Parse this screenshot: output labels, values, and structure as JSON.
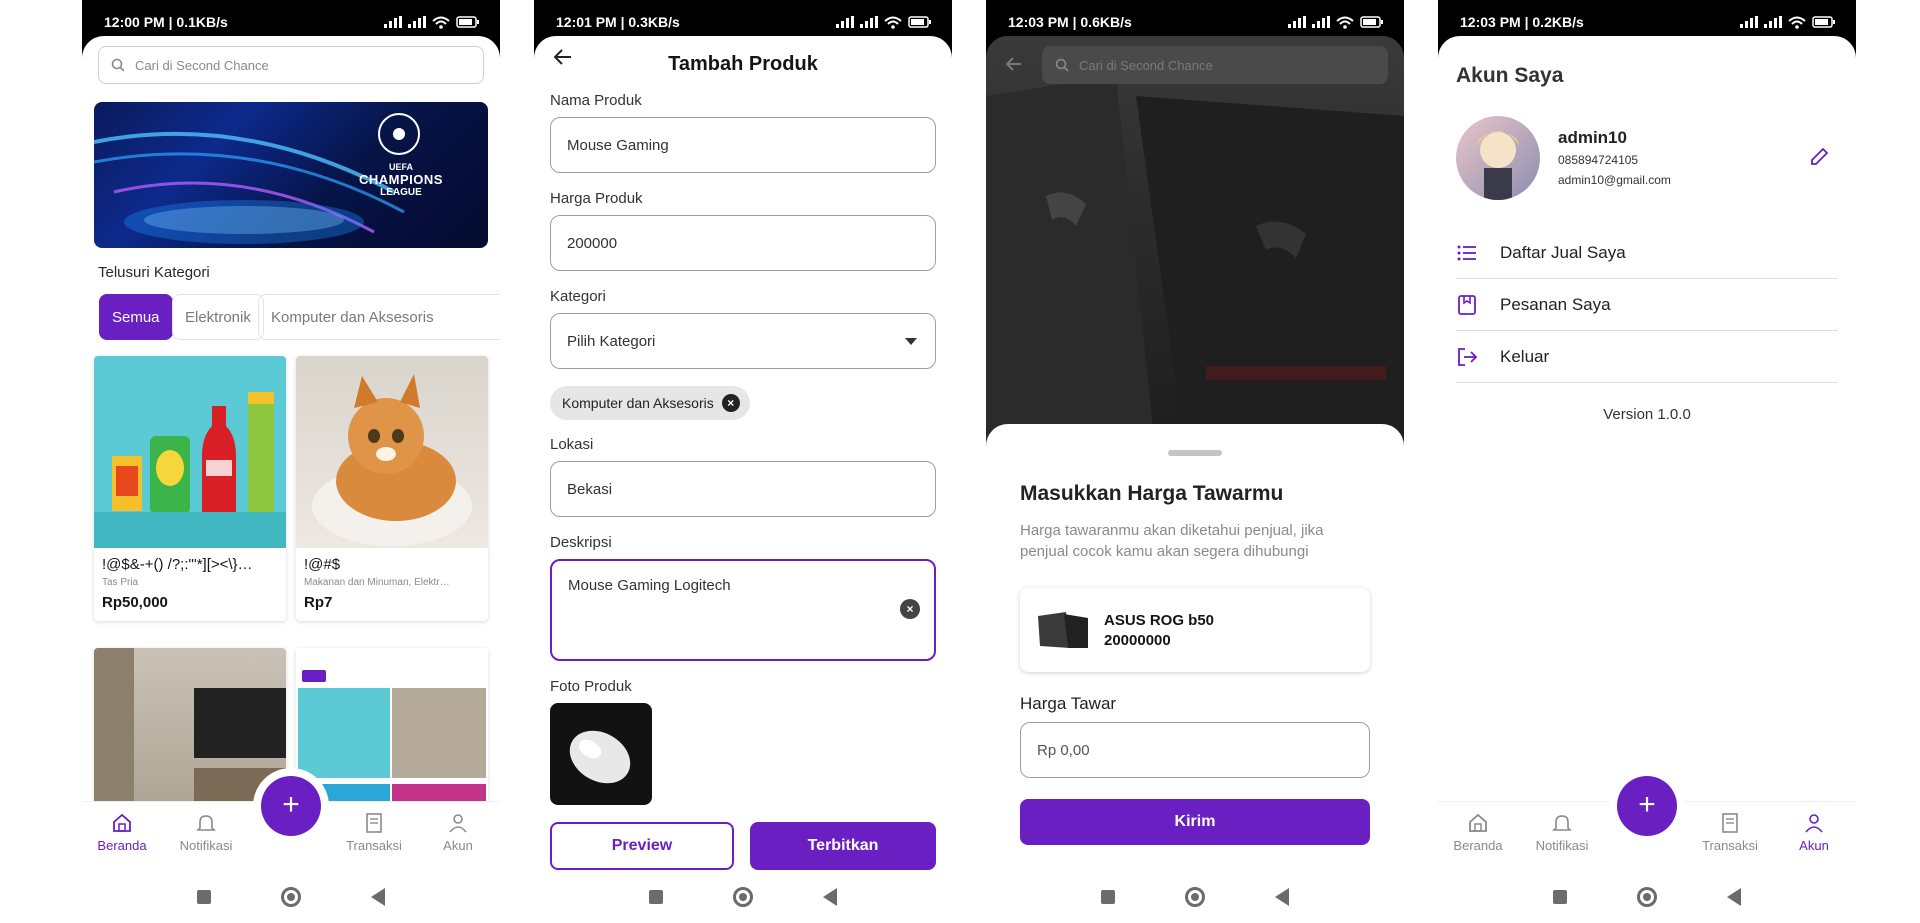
{
  "colors": {
    "accent": "#6a1fc2",
    "muted": "#8a8a8a"
  },
  "screens": {
    "home": {
      "status": {
        "time": "12:00 PM | 0.1KB/s"
      },
      "search": {
        "placeholder": "Cari di Second Chance"
      },
      "banner": {
        "brand_top": "UEFA",
        "brand_line1": "CHAMPIONS",
        "brand_line2": "LEAGUE"
      },
      "category_title": "Telusuri Kategori",
      "chips": [
        "Semua",
        "Elektronik",
        "Komputer dan Aksesoris"
      ],
      "products": [
        {
          "title": "!@$&-+() /?;:\"'*][><\\}…",
          "category": "Tas Pria",
          "price": "Rp50,000",
          "image": "snacks-image"
        },
        {
          "title": "!@#$",
          "category": "Makanan dan Minuman, Elektr…",
          "price": "Rp7",
          "image": "cat-image"
        }
      ],
      "nav": [
        "Beranda",
        "Notifikasi",
        "Transaksi",
        "Akun"
      ]
    },
    "add_product": {
      "status": {
        "time": "12:01 PM | 0.3KB/s"
      },
      "title": "Tambah Produk",
      "fields": {
        "name_label": "Nama Produk",
        "name_value": "Mouse Gaming",
        "price_label": "Harga Produk",
        "price_value": "200000",
        "category_label": "Kategori",
        "category_placeholder": "Pilih Kategori",
        "category_chip": "Komputer dan Aksesoris",
        "location_label": "Lokasi",
        "location_value": "Bekasi",
        "description_label": "Deskripsi",
        "description_value": "Mouse Gaming Logitech",
        "photo_label": "Foto Produk"
      },
      "buttons": {
        "preview": "Preview",
        "publish": "Terbitkan"
      }
    },
    "offer": {
      "status": {
        "time": "12:03 PM | 0.6KB/s"
      },
      "search": {
        "placeholder": "Cari di Second Chance"
      },
      "title": "Masukkan Harga Tawarmu",
      "subtitle": "Harga tawaranmu akan diketahui penjual, jika penjual cocok kamu akan segera dihubungi",
      "product": {
        "name": "ASUS ROG b50",
        "price": "20000000"
      },
      "offer_label": "Harga Tawar",
      "offer_placeholder": "Rp 0,00",
      "submit": "Kirim"
    },
    "account": {
      "status": {
        "time": "12:03 PM | 0.2KB/s"
      },
      "title": "Akun Saya",
      "user": {
        "name": "admin10",
        "phone": "085894724105",
        "email": "admin10@gmail.com"
      },
      "menu": [
        "Daftar Jual Saya",
        "Pesanan Saya",
        "Keluar"
      ],
      "version": "Version 1.0.0",
      "nav": [
        "Beranda",
        "Notifikasi",
        "Transaksi",
        "Akun"
      ]
    }
  }
}
